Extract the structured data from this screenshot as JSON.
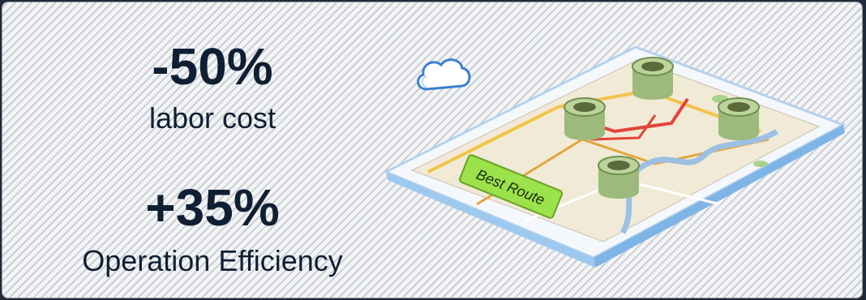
{
  "stats": [
    {
      "value": "-50%",
      "label": "labor cost"
    },
    {
      "value": "+35%",
      "label": "Operation Efficiency"
    }
  ],
  "illustration": {
    "route_label": "Best Route",
    "icons": [
      "cloud-icon",
      "tablet-map",
      "waste-bin-icon"
    ],
    "colors": {
      "route_label_bg": "#9be24b",
      "bin": "#9cba7b",
      "tablet_frame": "#f4f8fc",
      "map": "#f1ead7"
    }
  }
}
